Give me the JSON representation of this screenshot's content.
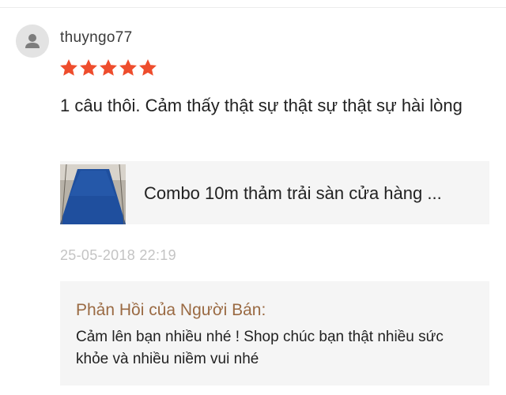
{
  "review": {
    "username": "thuyngo77",
    "rating": 5,
    "rating_max": 5,
    "comment": "1 câu thôi. Cảm thấy thật sự thật sự thật sự hài lòng",
    "timestamp": "25-05-2018 22:19"
  },
  "product": {
    "name": "Combo 10m thảm trải sàn cửa hàng ..."
  },
  "seller_reply": {
    "title": "Phản Hồi của Người Bán:",
    "text": "Cảm lên bạn nhiều nhé ! Shop chúc bạn thật nhiều sức khỏe và nhiều niềm vui nhé"
  },
  "colors": {
    "star": "#ee4d2d",
    "reply_title": "#9a6a43",
    "timestamp": "#c4c4c4",
    "panel_bg": "#f5f5f5"
  },
  "icons": {
    "avatar": "user-placeholder-icon",
    "star": "star-filled-icon"
  }
}
